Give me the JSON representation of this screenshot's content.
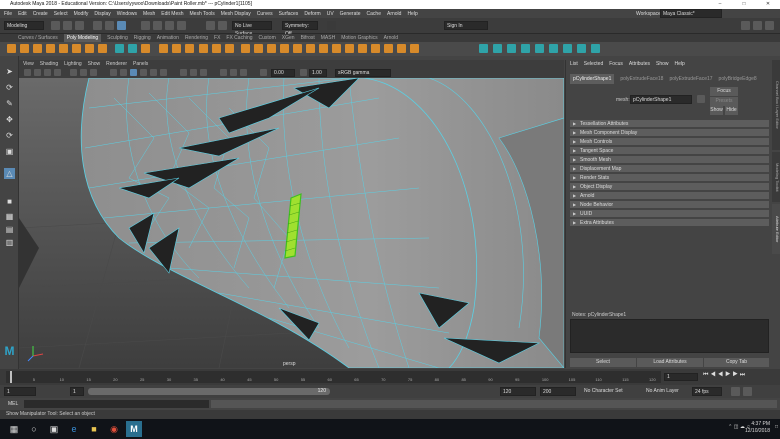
{
  "window": {
    "title": "Autodesk Maya 2018 - Educational Version: C:\\Users\\yywoo\\Downloads\\Paint Roller.mb* --- pCylinder1[1105]",
    "workspace_label": "Workspace:",
    "workspace_value": "Maya Classic*"
  },
  "menubar": [
    "File",
    "Edit",
    "Create",
    "Select",
    "Modify",
    "Display",
    "Windows",
    "Mesh",
    "Edit Mesh",
    "Mesh Tools",
    "Mesh Display",
    "Curves",
    "Surfaces",
    "Deform",
    "UV",
    "Generate",
    "Cache",
    "Arnold",
    "Help"
  ],
  "statusline": {
    "mode": "Modeling",
    "live_surface": "No Live Surface",
    "symmetry": "Symmetry: Off",
    "sign_in": "Sign In"
  },
  "shelf_tabs": [
    "Curves / Surfaces",
    "Poly Modeling",
    "Sculpting",
    "Rigging",
    "Animation",
    "Rendering",
    "FX",
    "FX Caching",
    "Custom",
    "XGen",
    "Bifrost",
    "MASH",
    "Motion Graphics",
    "Arnold"
  ],
  "shelf_active": "Poly Modeling",
  "viewport": {
    "menu": [
      "View",
      "Shading",
      "Lighting",
      "Show",
      "Renderer",
      "Panels"
    ],
    "exposure": "0.00",
    "gamma": "1.00",
    "color_space": "sRGB gamma",
    "camera_label": "persp"
  },
  "attribute_editor": {
    "menu": [
      "List",
      "Selected",
      "Focus",
      "Attributes",
      "Show",
      "Help"
    ],
    "tabs": [
      "pCylinderShape1",
      "polyExtrudeFace18",
      "polyExtrudeFace17",
      "polyBridgeEdge8"
    ],
    "active_tab": "pCylinderShape1",
    "mesh_label": "mesh:",
    "mesh_value": "pCylinderShape1",
    "focus_button": "Focus",
    "presets_button": "Presets",
    "show_button": "Show",
    "hide_button": "Hide",
    "sections": [
      "Tessellation Attributes",
      "Mesh Component Display",
      "Mesh Controls",
      "Tangent Space",
      "Smooth Mesh",
      "Displacement Map",
      "Render Stats",
      "Object Display",
      "Arnold",
      "Node Behavior",
      "UUID",
      "Extra Attributes"
    ],
    "notes_label": "Notes: pCylinderShape1",
    "select_button": "Select",
    "load_attributes_button": "Load Attributes",
    "copy_tab_button": "Copy Tab"
  },
  "side_tabs": [
    "Channel Box / Layer Editor",
    "Modeling Toolkit",
    "Attribute Editor"
  ],
  "timeslider": {
    "ticks": [
      "5",
      "10",
      "15",
      "20",
      "25",
      "30",
      "35",
      "40",
      "45",
      "50",
      "55",
      "60",
      "65",
      "70",
      "75",
      "80",
      "85",
      "90",
      "95",
      "100",
      "105",
      "110",
      "115",
      "120"
    ],
    "current_frame": "1"
  },
  "rangeslider": {
    "start": "1",
    "playback_start": "1",
    "range_label": "120",
    "playback_end": "120",
    "end": "200",
    "character_set": "No Character Set",
    "anim_layer": "No Anim Layer",
    "fps": "24 fps"
  },
  "cmdline": {
    "label": "MEL"
  },
  "helpline": {
    "text": "Show Manipulator Tool: Select an object"
  },
  "taskbar": {
    "time": "4:37 PM",
    "date": "12/10/2018"
  },
  "colors": {
    "accent": "#4fc3d9",
    "selection_green": "#7ddc1f",
    "viewport_bg": "#555555"
  }
}
